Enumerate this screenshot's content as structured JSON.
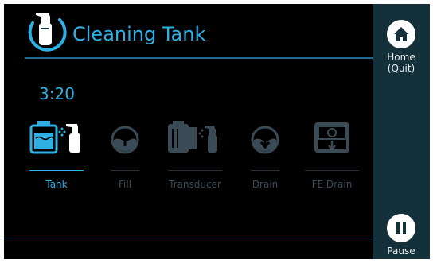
{
  "header": {
    "title": "Cleaning Tank"
  },
  "timer": "3:20",
  "steps": [
    {
      "label": "Tank",
      "state": "active"
    },
    {
      "label": "Fill",
      "state": "inactive"
    },
    {
      "label": "Transducer",
      "state": "inactive"
    },
    {
      "label": "Drain",
      "state": "inactive"
    },
    {
      "label": "FE Drain",
      "state": "inactive"
    }
  ],
  "sidebar": {
    "home_label_line1": "Home",
    "home_label_line2": "(Quit)",
    "pause_label": "Pause"
  },
  "colors": {
    "accent": "#2fb0e4",
    "inactive": "#3a4b55",
    "sidebar_bg": "#14303a",
    "screen_bg": "#000000"
  }
}
